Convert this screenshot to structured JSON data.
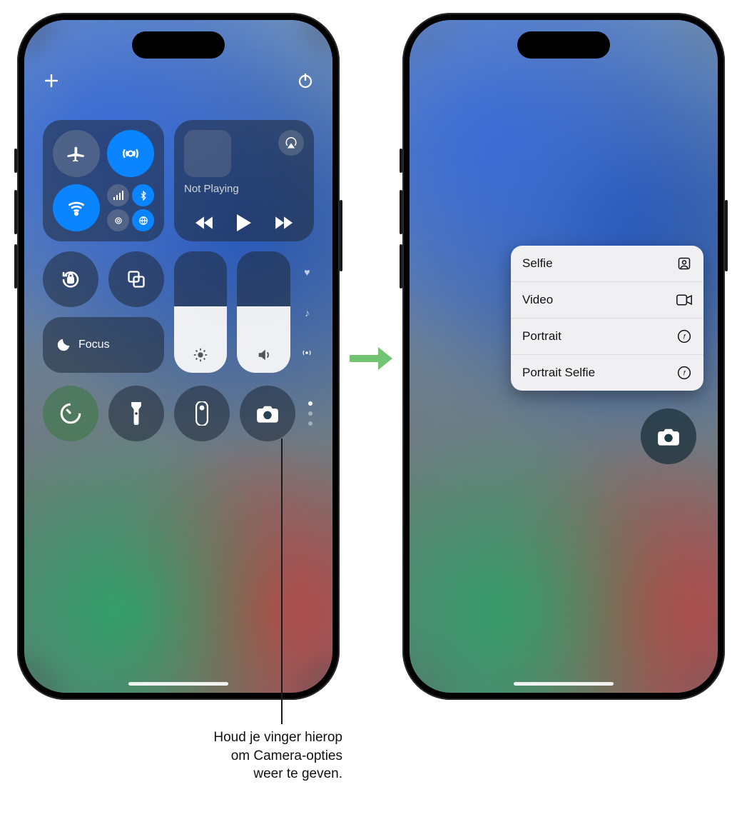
{
  "media": {
    "status": "Not Playing"
  },
  "focus": {
    "label": "Focus"
  },
  "brightness": {
    "percent": 55
  },
  "volume": {
    "percent": 55
  },
  "menu": {
    "items": [
      {
        "label": "Selfie",
        "icon": "person-square-icon"
      },
      {
        "label": "Video",
        "icon": "video-icon"
      },
      {
        "label": "Portrait",
        "icon": "aperture-icon"
      },
      {
        "label": "Portrait Selfie",
        "icon": "aperture-icon"
      }
    ]
  },
  "callout": {
    "line1": "Houd je vinger hierop",
    "line2": "om Camera-opties",
    "line3": "weer te geven."
  }
}
